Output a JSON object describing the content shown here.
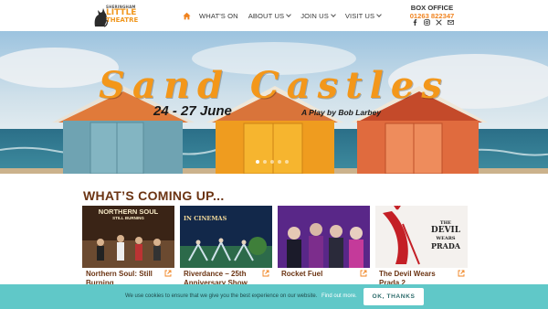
{
  "logo": {
    "line1": "SHERINGHAM",
    "line2": "LITTLE",
    "line3": "THEATRE"
  },
  "nav": {
    "home_icon": "home-icon",
    "items": [
      {
        "label": "WHAT'S ON",
        "has_dropdown": false
      },
      {
        "label": "ABOUT US",
        "has_dropdown": true
      },
      {
        "label": "JOIN US",
        "has_dropdown": true
      },
      {
        "label": "VISIT US",
        "has_dropdown": true
      }
    ]
  },
  "box_office": {
    "title": "BOX OFFICE",
    "phone": "01263 822347",
    "socials": [
      "facebook-icon",
      "instagram-icon",
      "x-icon",
      "email-icon"
    ]
  },
  "hero": {
    "title": "Sand Castles",
    "dates": "24 - 27 June",
    "byline": "A Play by Bob Larbey",
    "slide_count": 5,
    "active_slide": 1
  },
  "section": {
    "title": "WHAT’S COMING UP..."
  },
  "cards": [
    {
      "title": "Northern Soul: Still Burning",
      "image_caption_1": "NORTHERN SOUL",
      "image_caption_2": "STILL BURNING"
    },
    {
      "title": "Riverdance – 25th Anniversary Show",
      "image_caption_1": "IN CINEMAS"
    },
    {
      "title": "Rocket Fuel"
    },
    {
      "title": "The Devil Wears Prada 2",
      "image_caption_1": "THE",
      "image_caption_2": "DEVIL",
      "image_caption_3": "WEARS",
      "image_caption_4": "PRADA"
    }
  ],
  "cookie": {
    "text": "We use cookies to ensure that we give you the best experience on our website.",
    "link": "Find out more.",
    "button": "OK, THANKS"
  },
  "colors": {
    "accent": "#f0831f",
    "heading": "#6b3413",
    "cookie_bg": "#60c8c8"
  }
}
